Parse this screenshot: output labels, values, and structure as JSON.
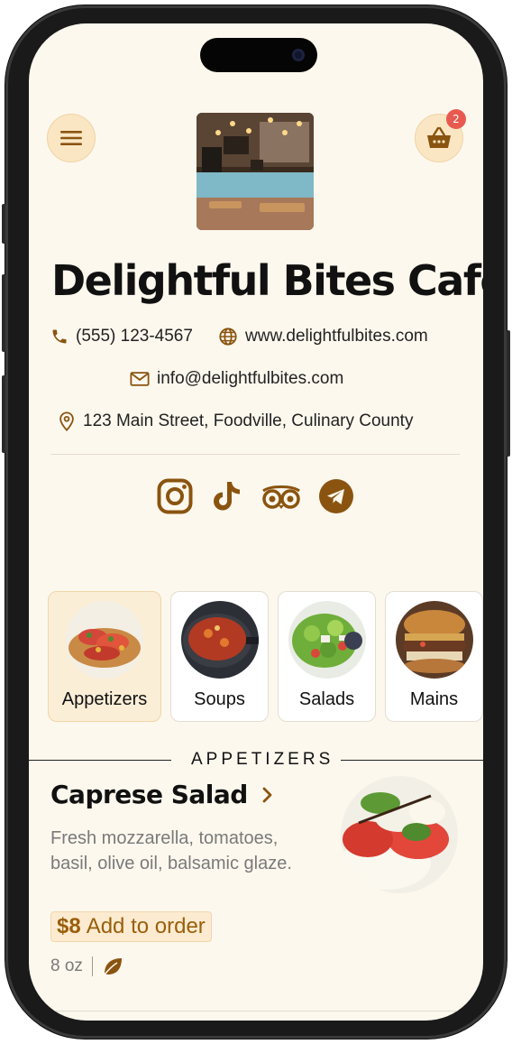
{
  "header": {
    "menu_icon": "hamburger-menu-icon",
    "cart_icon": "basket-icon",
    "cart_count": "2",
    "cafe_image": "cafe-interior-photo"
  },
  "cafe": {
    "name": "Delightful Bites Cafe",
    "phone": "(555) 123-4567",
    "website": "www.delightfulbites.com",
    "email": "info@delightfulbites.com",
    "address": "123 Main Street, Foodville, Culinary County"
  },
  "social": [
    {
      "name": "instagram-icon"
    },
    {
      "name": "tiktok-icon"
    },
    {
      "name": "tripadvisor-icon"
    },
    {
      "name": "telegram-icon"
    }
  ],
  "categories": [
    {
      "label": "Appetizers",
      "active": true
    },
    {
      "label": "Soups",
      "active": false
    },
    {
      "label": "Salads",
      "active": false
    },
    {
      "label": "Mains",
      "active": false
    }
  ],
  "section": {
    "title": "APPETIZERS"
  },
  "menu_item": {
    "name": "Caprese Salad",
    "description": "Fresh mozzarella, tomatoes, basil, olive oil, balsamic glaze.",
    "price": "$8",
    "add_label": "Add to order",
    "weight": "8 oz",
    "diet_icon": "leaf-icon"
  },
  "colors": {
    "accent": "#9a5f0c",
    "background": "#fdf8ee",
    "badge": "#e85a50"
  }
}
